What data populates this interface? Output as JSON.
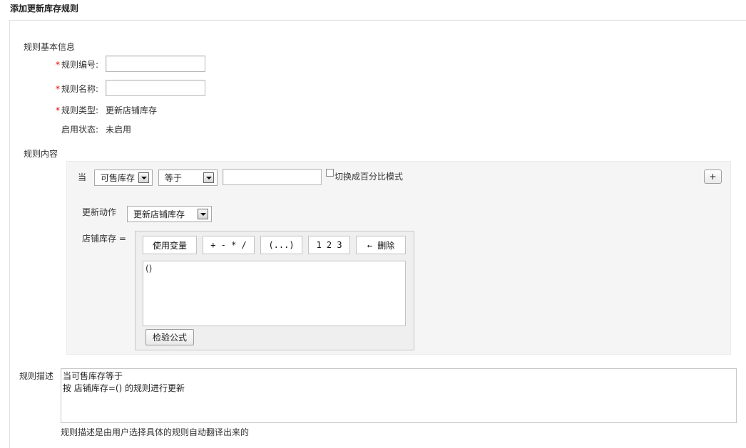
{
  "page": {
    "title": "添加更新库存规则"
  },
  "basic_info": {
    "section_label": "规则基本信息",
    "rule_code": {
      "label": "规则编号:",
      "value": "",
      "required_mark": "*"
    },
    "rule_name": {
      "label": "规则名称:",
      "value": "",
      "required_mark": "*"
    },
    "rule_type": {
      "label": "规则类型:",
      "value": "更新店铺库存",
      "required_mark": "*"
    },
    "status": {
      "label": "启用状态:",
      "value": "未启用"
    }
  },
  "content": {
    "section_label": "规则内容",
    "condition": {
      "prefix": "当",
      "field_select": "可售库存",
      "operator_select": "等于",
      "value": "",
      "percent_checkbox_label": "切换成百分比模式",
      "percent_checked": false,
      "add_button": "+"
    },
    "action": {
      "label": "更新动作",
      "select": "更新店铺库存"
    },
    "formula": {
      "label": "店铺库存 =",
      "toolbar": [
        "使用变量",
        "+ - * /",
        "(...)",
        "1 2 3",
        "← 删除"
      ],
      "value": "()",
      "validate_button": "检验公式"
    }
  },
  "description": {
    "label": "规则描述",
    "line1": "当可售库存等于",
    "line2": "按 店铺库存=() 的规则进行更新",
    "hint": "规则描述是由用户选择具体的规则自动翻译出来的"
  }
}
